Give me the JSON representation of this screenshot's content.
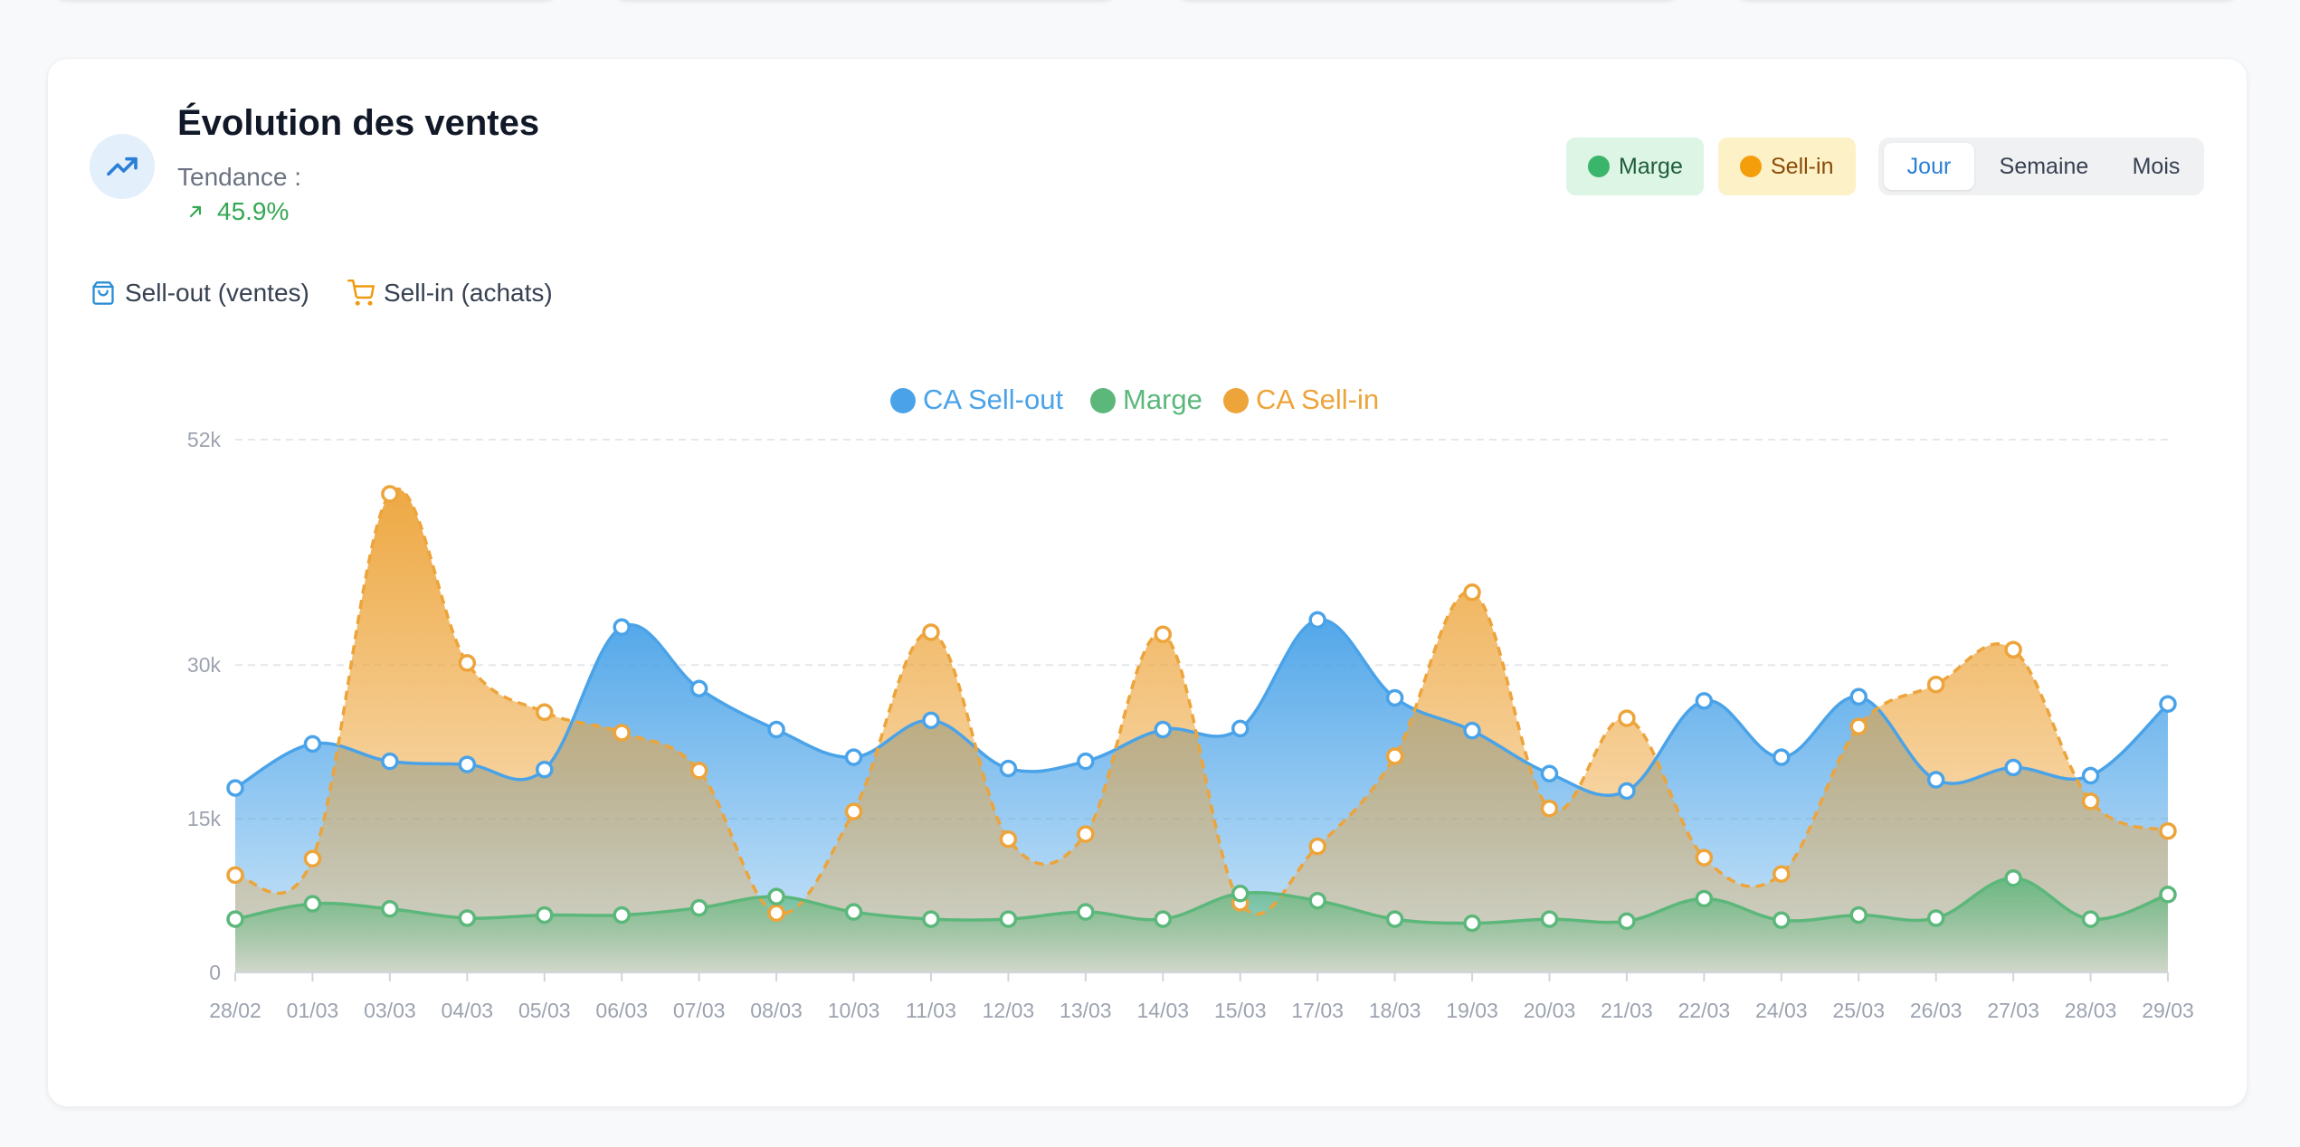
{
  "card": {
    "title": "Évolution des ventes",
    "trend_label": "Tendance :",
    "trend_value": "45.9%"
  },
  "toggles": {
    "marge": "Marge",
    "sellin": "Sell-in"
  },
  "periods": [
    "Jour",
    "Semaine",
    "Mois"
  ],
  "active_period": "Jour",
  "mode_legend": {
    "sellout": "Sell-out (ventes)",
    "sellin": "Sell-in (achats)"
  },
  "colors": {
    "sellout": "#4aa3e8",
    "marge": "#5cb77b",
    "sellin": "#eda43a",
    "trend": "#34a853"
  },
  "chart_data": {
    "type": "area",
    "title": "",
    "xlabel": "",
    "ylabel": "",
    "ylim": [
      0,
      52000
    ],
    "y_ticks": [
      {
        "value": 0,
        "label": "0"
      },
      {
        "value": 15000,
        "label": "15k"
      },
      {
        "value": 30000,
        "label": "30k"
      },
      {
        "value": 52000,
        "label": "52k"
      }
    ],
    "grid": true,
    "legend_position": "top-center",
    "categories": [
      "28/02",
      "01/03",
      "03/03",
      "04/03",
      "05/03",
      "06/03",
      "07/03",
      "08/03",
      "10/03",
      "11/03",
      "12/03",
      "13/03",
      "14/03",
      "15/03",
      "17/03",
      "18/03",
      "19/03",
      "20/03",
      "21/03",
      "22/03",
      "24/03",
      "25/03",
      "26/03",
      "27/03",
      "28/03",
      "29/03"
    ],
    "series": [
      {
        "name": "CA Sell-out",
        "style": "solid",
        "values": [
          18000,
          22300,
          20600,
          20300,
          19800,
          33700,
          27700,
          23700,
          21000,
          24600,
          19900,
          20600,
          23700,
          23800,
          34400,
          26800,
          23600,
          19400,
          17700,
          26500,
          21000,
          26900,
          18800,
          20000,
          19200,
          26200
        ]
      },
      {
        "name": "Marge",
        "style": "solid",
        "values": [
          5200,
          6700,
          6200,
          5300,
          5600,
          5600,
          6300,
          7400,
          5900,
          5200,
          5200,
          5900,
          5200,
          7700,
          7000,
          5200,
          4800,
          5200,
          5000,
          7200,
          5100,
          5600,
          5300,
          9200,
          5200,
          7600
        ]
      },
      {
        "name": "CA Sell-in",
        "style": "dashed",
        "values": [
          9500,
          11100,
          46700,
          30200,
          25400,
          23400,
          19700,
          5800,
          15700,
          33200,
          13000,
          13500,
          33000,
          6800,
          12300,
          21100,
          37100,
          16000,
          24800,
          11200,
          9600,
          24000,
          28100,
          31500,
          16700,
          13800
        ]
      }
    ]
  }
}
